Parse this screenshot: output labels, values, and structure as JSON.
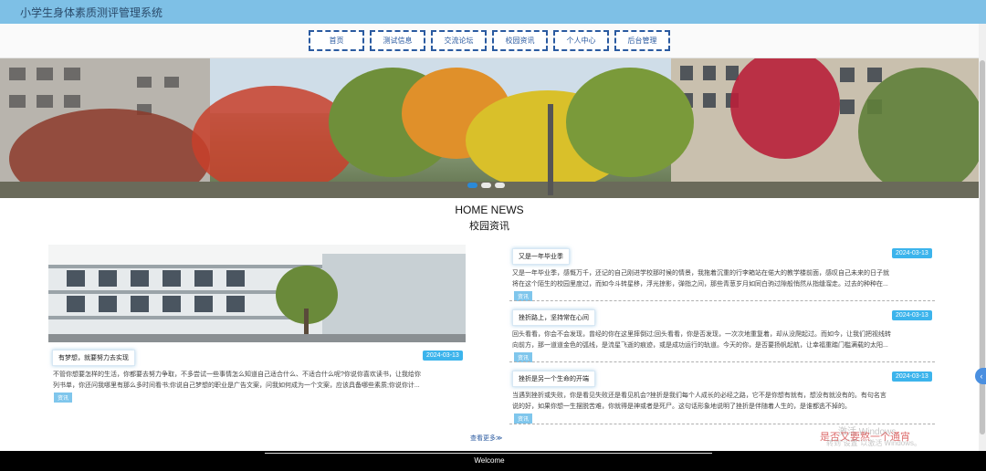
{
  "app": {
    "title": "小学生身体素质测评管理系统"
  },
  "nav": {
    "items": [
      "首页",
      "测试信息",
      "交流论坛",
      "校园资讯",
      "个人中心",
      "后台管理"
    ]
  },
  "section": {
    "title_en": "HOME NEWS",
    "title_cn": "校园资讯"
  },
  "featured": {
    "title": "有梦想，就要努力去实现",
    "date": "2024-03-13",
    "summary_line1": "不管你想要怎样的生活，你都要去努力争取，不多尝试一些事情怎么知道自己适合什么、不适合什么呢?你说你喜欢读书，让我给你",
    "summary_line2": "列书单，你还问我哪里有那么多时间看书;你说自己梦想的职业是广告文案，问我如何成为一个文案，应该具备哪些素质;你说你计...",
    "category": "资讯"
  },
  "news": [
    {
      "title": "又是一年毕业季",
      "date": "2024-03-13",
      "line1": "又是一年毕业季，感慨万千，还记的自己刚进学校那时候的情景，我拖着沉重的行李箱站在偌大的教学楼前面，感叹自己未来的日子就",
      "line2": "将在这个陌生的校园里度过，而如今斗转星移，浮光掠影，弹指之间，那些青葱岁月如同白驹过隙般悄然从指缝溜走。过去的种种在...",
      "category": "资讯"
    },
    {
      "title": "挫折路上，坚持常在心间",
      "date": "2024-03-13",
      "line1": "回头看看，你会不会发现，曾经的你在这里摔倒过;回头看看，你是否发现，一次次地重复着，却从没爬起过。而如今，让我们把视线转",
      "line2": "向前方，那一道道金色的弧线，是流星飞逝的痕迹，或是成功运行的轨道。今天的你，是否要扬帆起航，让幸福重踏门槛满载的太阳...",
      "category": "资讯"
    },
    {
      "title": "挫折是另一个生命的开端",
      "date": "2024-03-13",
      "line1": "当遇到挫折或失败，你是看见失败还是看见机会?挫折是我们每个人成长的必经之路，它不是你想有就有，想没有就没有的。有句名言",
      "line2": "说的好，如果你想一生摆脱苦难，你就得是神或者是死尸。这句话形象地说明了挫折是伴随着人生的，是谁都逃不掉的。",
      "category": "资讯"
    }
  ],
  "more_link": "查看更多≫",
  "footer": {
    "welcome": "Welcome"
  },
  "watermark": {
    "line1": "激活 Windows",
    "line2": "是否又要熬一个通宵",
    "line3": "转到“设置”以激活 Windows。"
  },
  "icons": {
    "side_arrow": "chevron-left-icon"
  },
  "colors": {
    "topbar": "#7ec0e6",
    "nav_border": "#2a5aa0",
    "date_badge": "#3cb4ec",
    "category_badge": "#7fc6ec"
  }
}
